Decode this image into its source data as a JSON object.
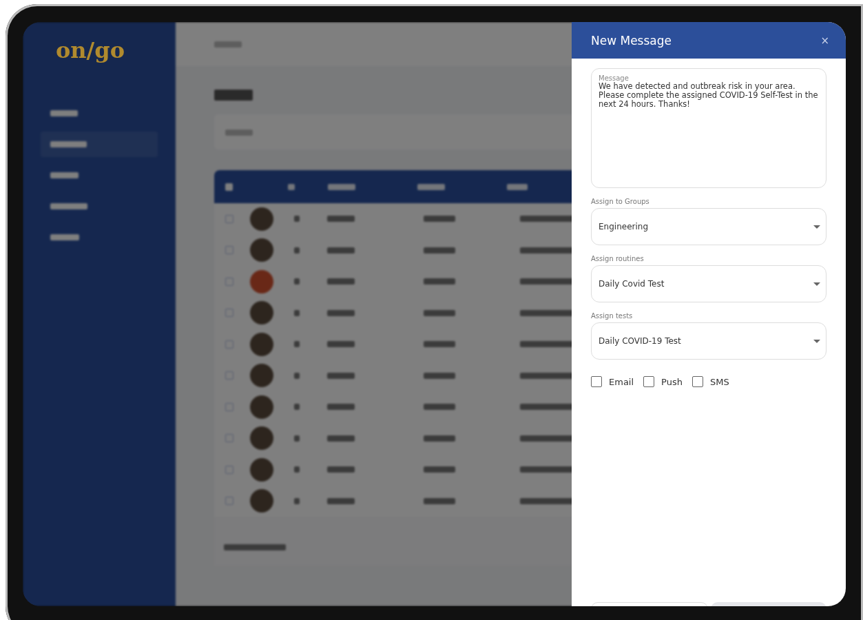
{
  "logo": "on/go",
  "dialog": {
    "title": "New Message",
    "close": "×",
    "message": {
      "label": "Message",
      "value": "We have detected and outbreak risk in your area. Please complete the assigned COVID-19 Self-Test in the next 24 hours. Thanks!"
    },
    "selects": [
      {
        "label": "Assign to Groups",
        "value": "Engineering"
      },
      {
        "label": "Assign routines",
        "value": "Daily Covid Test"
      },
      {
        "label": "Assign tests",
        "value": "Daily COVID-19 Test"
      }
    ],
    "channels": [
      {
        "label": "Email",
        "checked": false
      },
      {
        "label": "Push",
        "checked": false
      },
      {
        "label": "SMS",
        "checked": false
      }
    ],
    "footer_buttons": [
      {
        "kind": "outline"
      },
      {
        "kind": "filled"
      }
    ]
  }
}
